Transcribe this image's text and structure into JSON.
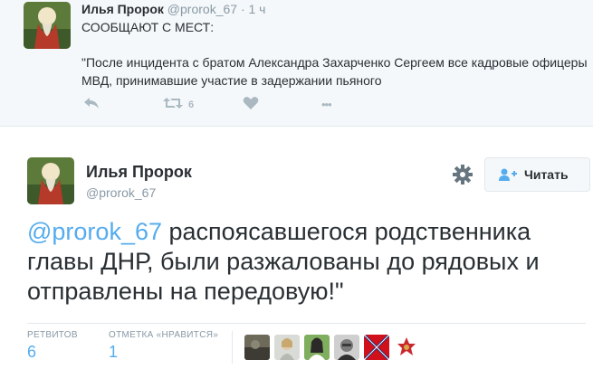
{
  "parent_tweet": {
    "name": "Илья Пророк",
    "handle": "@prorok_67",
    "time": "· 1 ч",
    "line1": "СООБЩАЮТ С МЕСТ:",
    "quote": "\"После инцидента с братом Александра Захарченко Сергеем все кадровые офицеры МВД, принимавшие участие в задержании пьяного",
    "retweet_count": "6",
    "more_glyph": "•••",
    "icons": [
      "reply-icon",
      "retweet-icon",
      "like-icon",
      "more-icon"
    ]
  },
  "main_tweet": {
    "name": "Илья Пророк",
    "handle": "@prorok_67",
    "follow_label": "Читать",
    "text_mention": "@prorok_67",
    "text_body": " распоясавшегося родственника главы ДНР, были разжалованы до рядовых и отправлены на передовую!\"",
    "stats": {
      "retweets_label": "РЕТВИТОВ",
      "retweets_value": "6",
      "likes_label": "ОТМЕТКА «НРАВИТСЯ»",
      "likes_value": "1"
    }
  },
  "colors": {
    "accent": "#55acee",
    "muted": "#8899a6",
    "text": "#292f33",
    "background_light": "#f5f8fa"
  }
}
